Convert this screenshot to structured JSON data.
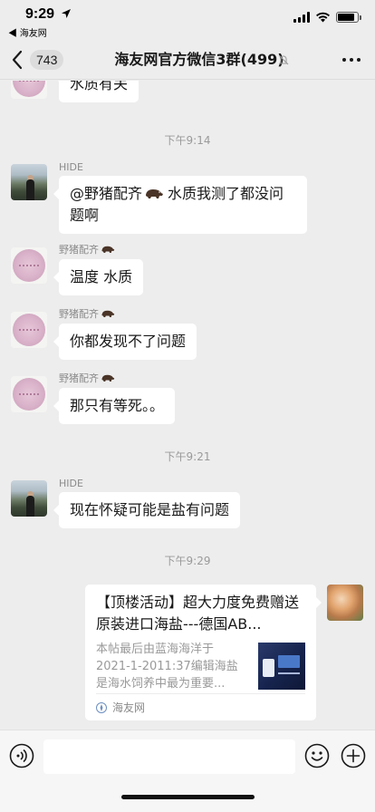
{
  "status_bar": {
    "time": "9:29",
    "back_app": "◀ 海友网",
    "battery_level": 0.85
  },
  "nav": {
    "unread_count": "743",
    "title": "海友网官方微信3群(499)",
    "icons": [
      "back-chevron-icon",
      "mute-bell-icon",
      "more-icon"
    ]
  },
  "messages": [
    {
      "type": "text",
      "sender": "",
      "text": "水质有关"
    },
    {
      "type": "time",
      "text": "下午9:14"
    },
    {
      "type": "text",
      "sender": "HIDE",
      "text_before": "@野猪配齐",
      "text_after": "水质我测了都没问题啊"
    },
    {
      "type": "text",
      "sender": "野猪配齐",
      "text": "温度  水质"
    },
    {
      "type": "text",
      "sender": "野猪配齐",
      "text": "你都发现不了问题"
    },
    {
      "type": "text",
      "sender": "野猪配齐",
      "text": "那只有等死。。"
    },
    {
      "type": "time",
      "text": "下午9:21"
    },
    {
      "type": "text",
      "sender": "HIDE",
      "text": "现在怀疑可能是盐有问题"
    },
    {
      "type": "time",
      "text": "下午9:29"
    }
  ],
  "link_card": {
    "title": "【顶楼活动】超大力度免费赠送原装进口海盐---德国AB...",
    "description": "本帖最后由蓝海海洋于2021-1-2011:37编辑海盐是海水饲养中最为重要...",
    "source": "海友网"
  },
  "input_bar": {
    "placeholder": "",
    "icons": [
      "voice-icon",
      "emoji-icon",
      "plus-icon"
    ]
  },
  "colors": {
    "background": "#ededed",
    "bubble": "#ffffff",
    "text": "#191919",
    "meta": "#9a9a9a"
  }
}
